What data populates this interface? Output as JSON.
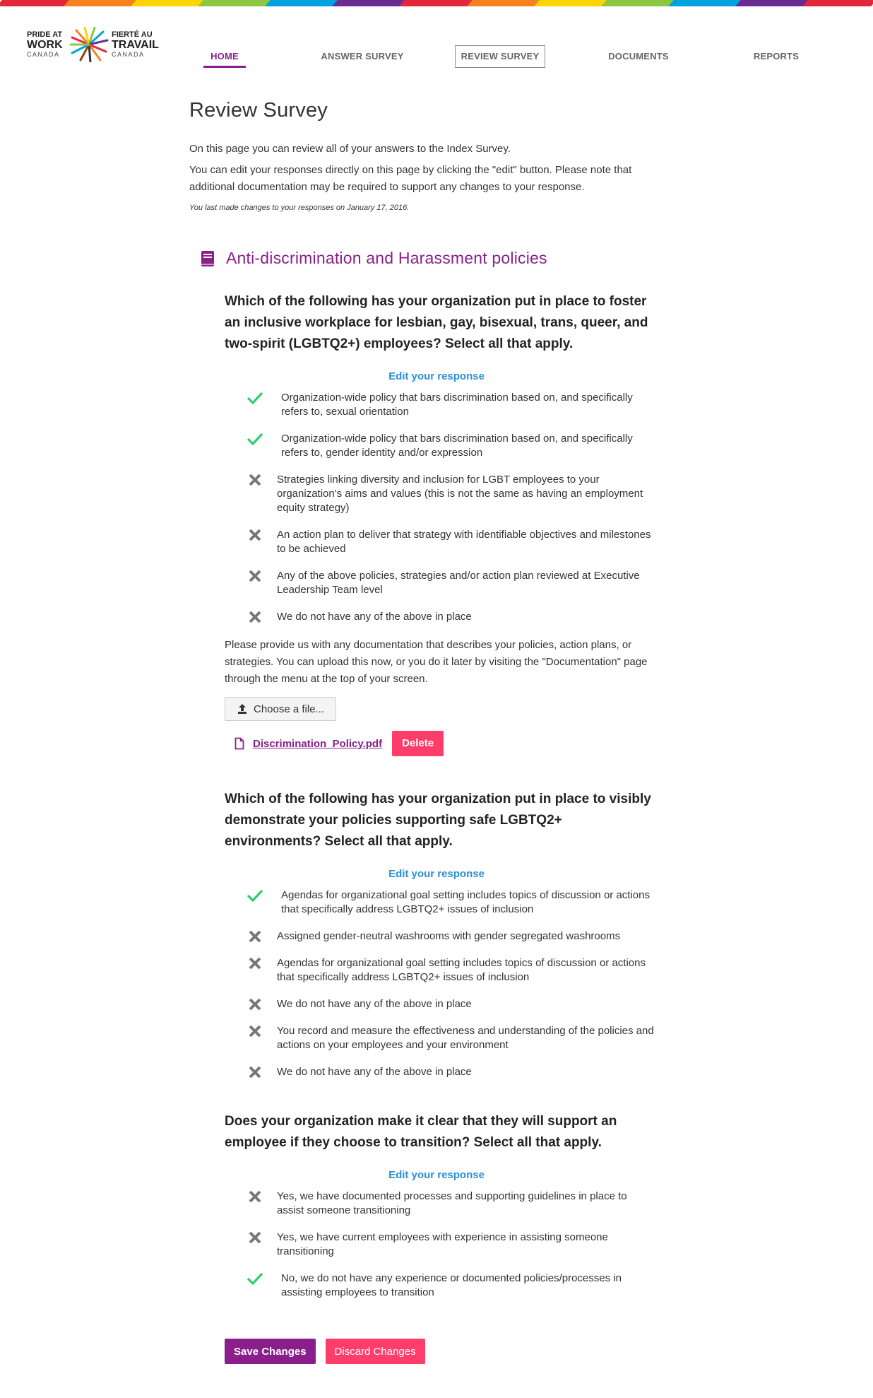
{
  "brand": {
    "en_line1": "PRIDE AT",
    "en_line2": "WORK",
    "en_line3": "CANADA",
    "fr_line1": "FIERTÉ AU",
    "fr_line2": "TRAVAIL",
    "fr_line3": "CANADA",
    "rainbow": [
      "#e4263a",
      "#f5821f",
      "#ffd400",
      "#8dc63f",
      "#00a3e0",
      "#6b2c91",
      "#e4263a",
      "#f5821f",
      "#ffd400",
      "#8dc63f",
      "#00a3e0",
      "#6b2c91",
      "#e4263a"
    ]
  },
  "nav": {
    "home": "HOME",
    "answer_survey": "ANSWER SURVEY",
    "review_survey": "REVIEW SURVEY",
    "documents": "DOCUMENTS",
    "reports": "REPORTS"
  },
  "page": {
    "title": "Review Survey",
    "intro1": "On this page you can review all of your answers to the Index Survey.",
    "intro2": "You can edit your responses directly on this page by clicking the \"edit\" button. Please note that additional documentation may be required to support any changes to your response.",
    "last_changed": "You last made changes to your responses on January 17, 2016."
  },
  "section": {
    "title": "Anti-discrimination and Harassment policies",
    "icon": "book-icon"
  },
  "questions": [
    {
      "text": "Which of the following has your organization put in place to foster an inclusive workplace for lesbian, gay, bisexual, trans, queer, and two-spirit (LGBTQ2+) employees? Select all that apply.",
      "edit_label": "Edit your response",
      "answers": [
        {
          "selected": true,
          "text": "Organization-wide policy that bars discrimination based on, and specifically refers to, sexual orientation"
        },
        {
          "selected": true,
          "text": "Organization-wide policy that bars discrimination based on, and specifically refers to, gender identity and/or expression"
        },
        {
          "selected": false,
          "text": "Strategies linking diversity and inclusion for LGBT employees to your organization's aims and values (this is not the same as having an employment equity strategy)"
        },
        {
          "selected": false,
          "text": "An action plan to deliver that strategy with identifiable objectives and milestones to be achieved"
        },
        {
          "selected": false,
          "text": "Any of the above policies, strategies and/or action plan reviewed at Executive Leadership Team level"
        },
        {
          "selected": false,
          "text": "We do not have any of the above in place"
        }
      ],
      "doc_text": "Please provide us with any documentation that describes your policies, action plans, or strategies. You can upload this now, or you do it later by visiting the \"Documentation\" page through the menu at the top of your screen.",
      "upload_label": "Choose a file...",
      "file_name": "Discrimination_Policy.pdf",
      "delete_label": "Delete"
    },
    {
      "text": "Which of the following has your organization put in place to visibly demonstrate your policies supporting safe LGBTQ2+ environments? Select all that apply.",
      "edit_label": "Edit your response",
      "answers": [
        {
          "selected": true,
          "text": "Agendas for organizational goal setting includes topics of discussion or actions that specifically address LGBTQ2+ issues of inclusion"
        },
        {
          "selected": false,
          "text": "Assigned gender-neutral washrooms with gender segregated washrooms"
        },
        {
          "selected": false,
          "text": "Agendas for organizational goal setting includes topics of discussion or actions that specifically address LGBTQ2+ issues of inclusion"
        },
        {
          "selected": false,
          "text": "We do not have any of the above in place"
        },
        {
          "selected": false,
          "text": "You record and measure the effectiveness and understanding of the policies and actions on your employees and your environment"
        },
        {
          "selected": false,
          "text": "We do not have any of the above in place"
        }
      ]
    },
    {
      "text": "Does your organization make it clear that they will support an employee if they choose to transition? Select all that apply.",
      "edit_label": "Edit your response",
      "answers": [
        {
          "selected": false,
          "text": "Yes, we have documented processes and supporting guidelines in place to assist someone transitioning"
        },
        {
          "selected": false,
          "text": "Yes, we have current employees with experience in assisting someone transitioning"
        },
        {
          "selected": true,
          "text": "No, we do not have any experience or documented policies/processes in assisting employees to transition"
        }
      ]
    }
  ],
  "actions": {
    "save": "Save Changes",
    "discard": "Discard Changes"
  },
  "colors": {
    "brand_purple": "#8a1f8c",
    "link_blue": "#2a8fd8",
    "danger_pink": "#ff3d6a",
    "check_green": "#2ecc71",
    "cross_gray": "#777777"
  }
}
